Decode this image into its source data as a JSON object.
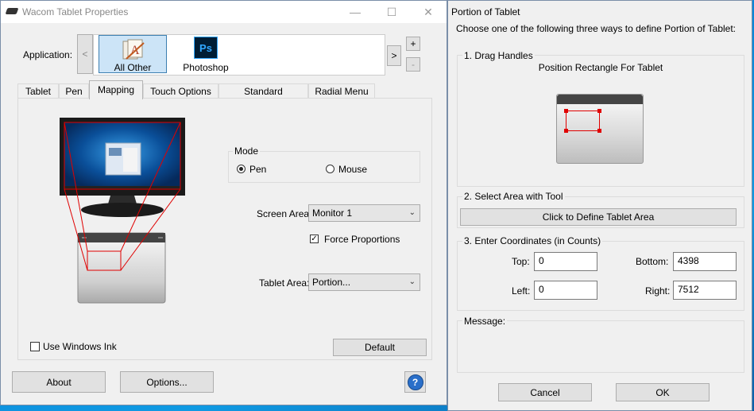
{
  "main_window": {
    "title": "Wacom Tablet Properties",
    "application_label": "Application:",
    "apps": [
      {
        "label": "All Other"
      },
      {
        "label": "Photoshop",
        "icon_text": "Ps"
      }
    ],
    "plus_label": "+",
    "minus_label": "-",
    "left_arrow": "<",
    "right_arrow": ">",
    "tabs": [
      {
        "label": "Tablet"
      },
      {
        "label": "Pen"
      },
      {
        "label": "Mapping"
      },
      {
        "label": "Touch Options"
      },
      {
        "label": "Standard Gestures"
      },
      {
        "label": "Radial Menu"
      }
    ],
    "mode": {
      "label": "Mode",
      "pen_label": "Pen",
      "mouse_label": "Mouse",
      "selected": "Pen"
    },
    "screen_area": {
      "label": "Screen Area:",
      "value": "Monitor 1"
    },
    "force_proportions": {
      "label": "Force Proportions",
      "checked": true
    },
    "tablet_area": {
      "label": "Tablet Area:",
      "value": "Portion..."
    },
    "use_windows_ink": {
      "label": "Use Windows Ink",
      "checked": false
    },
    "default_button": "Default",
    "about_button": "About",
    "options_button": "Options...",
    "help_icon_text": "?"
  },
  "portion_dialog": {
    "title": "Portion of Tablet",
    "instruction": "Choose one of the following three ways to define Portion of Tablet:",
    "drag_handles": {
      "label": "1. Drag Handles",
      "caption": "Position Rectangle For Tablet"
    },
    "select_area": {
      "label": "2. Select Area with Tool",
      "button": "Click to Define Tablet Area"
    },
    "coordinates": {
      "label": "3. Enter Coordinates (in Counts)",
      "top_label": "Top:",
      "top_value": "0",
      "bottom_label": "Bottom:",
      "bottom_value": "4398",
      "left_label": "Left:",
      "left_value": "0",
      "right_label": "Right:",
      "right_value": "7512"
    },
    "message_label": "Message:",
    "cancel_button": "Cancel",
    "ok_button": "OK"
  },
  "colors": {
    "accent_red": "#e00000",
    "selected_app_bg": "#cce4f7",
    "desktop_blue": "#0b86d8"
  }
}
